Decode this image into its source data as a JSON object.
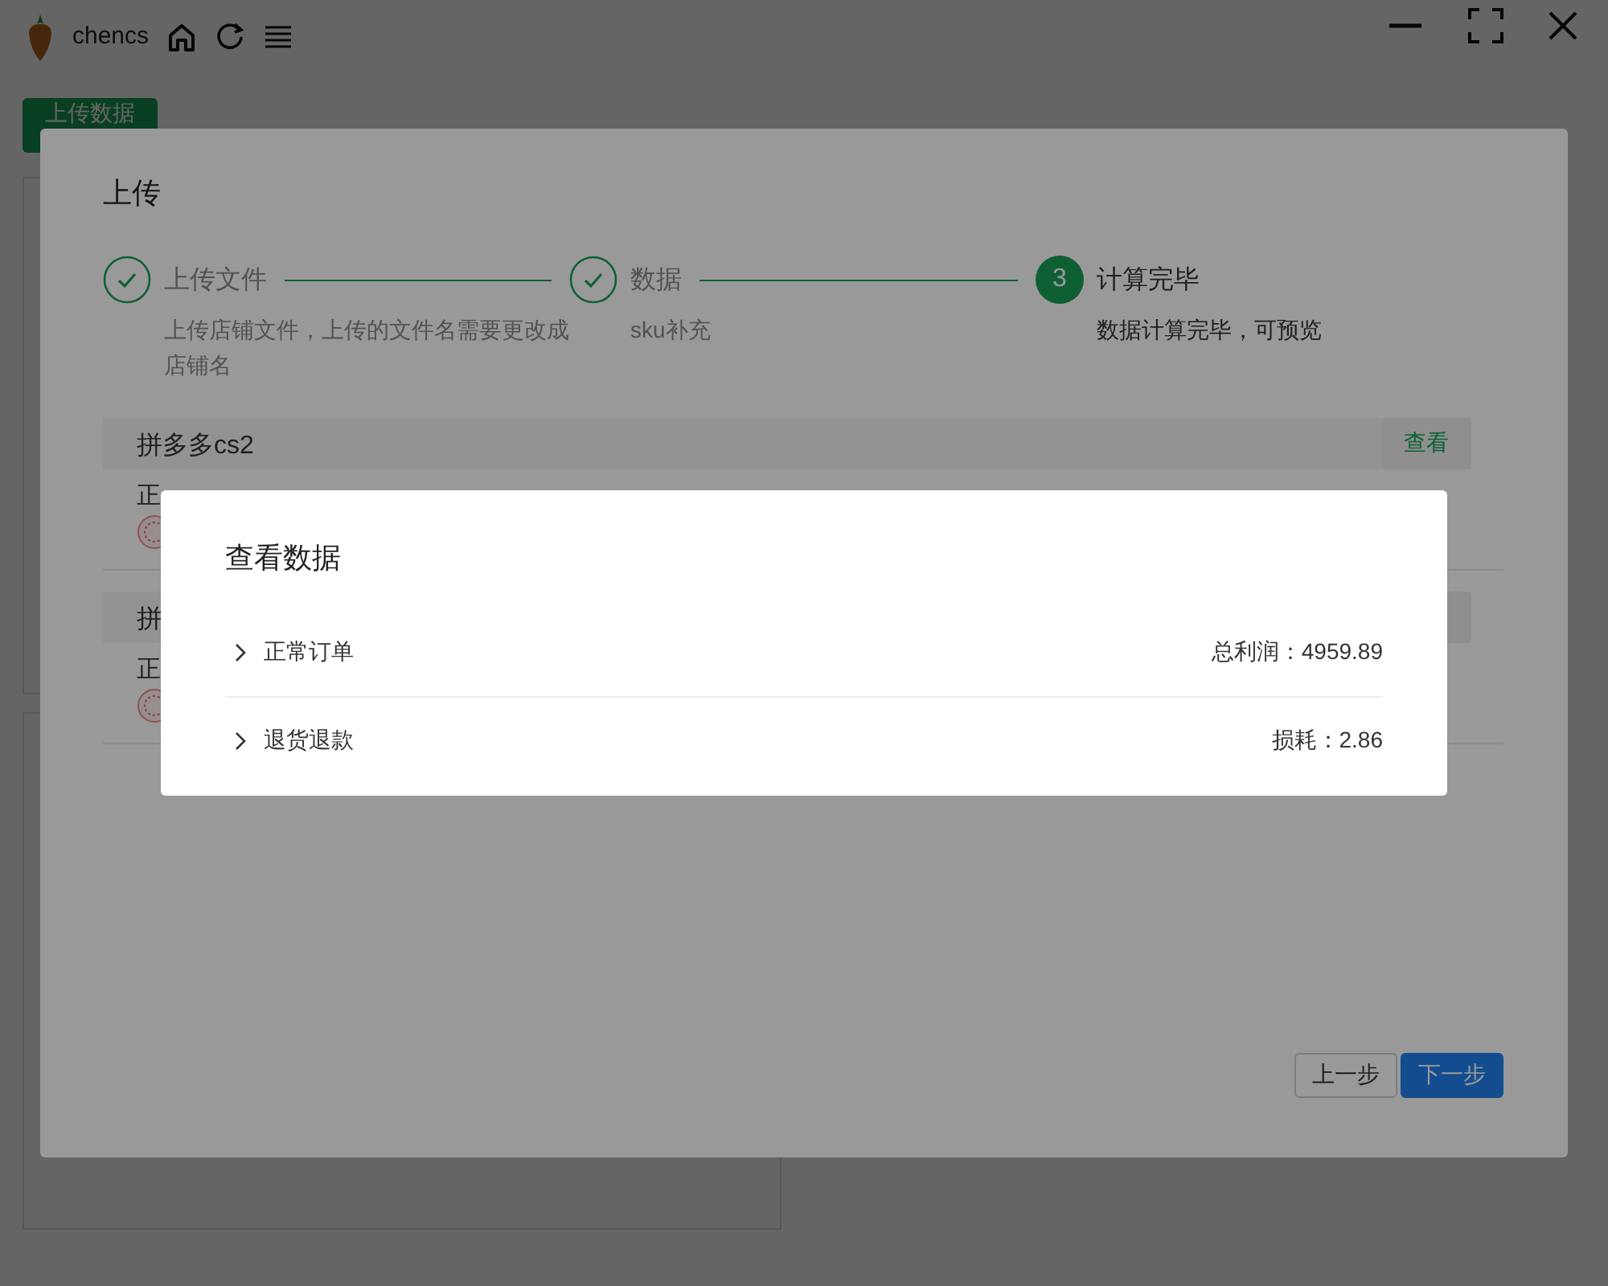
{
  "app": {
    "title": "chencs",
    "upload_button": "上传数据"
  },
  "dialog": {
    "title": "上传",
    "steps": [
      {
        "title": "上传文件",
        "description": "上传店铺文件，上传的文件名需要更改成店铺名",
        "done": true
      },
      {
        "title": "数据",
        "description": "sku补充",
        "done": true
      },
      {
        "title": "计算完毕",
        "description": "数据计算完毕，可预览",
        "done": false,
        "number": "3"
      }
    ],
    "shops": [
      {
        "name": "拼多多cs2",
        "status": "正",
        "button": "查看"
      },
      {
        "name": "拼",
        "status": "正"
      }
    ],
    "buttons": [
      {
        "label": "上一步",
        "kind": "default"
      },
      {
        "label": "下一步",
        "kind": "primary"
      }
    ]
  },
  "modal": {
    "title": "查看数据",
    "rows": [
      {
        "label": "正常订单",
        "value": "总利润：4959.89",
        "expanded": false
      },
      {
        "label": "退货退款",
        "value": "损耗：2.86",
        "expanded": false
      }
    ]
  }
}
